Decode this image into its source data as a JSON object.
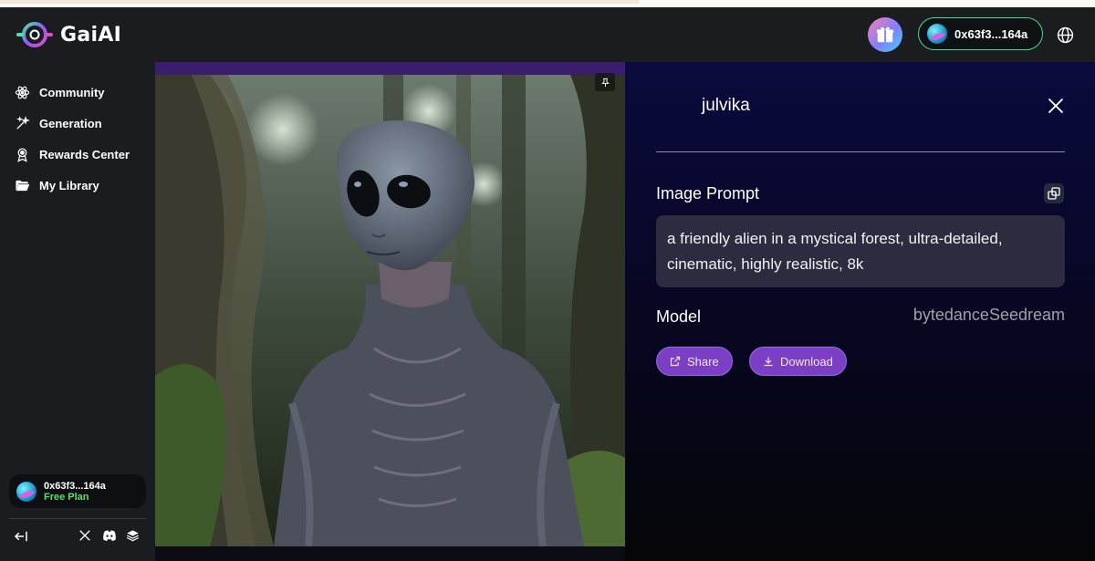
{
  "app": {
    "brand": "GaiAI"
  },
  "header": {
    "wallet_address": "0x63f3...164a"
  },
  "sidebar": {
    "items": [
      {
        "label": "Community",
        "icon": "atom-icon"
      },
      {
        "label": "Generation",
        "icon": "magic-wand-icon"
      },
      {
        "label": "Rewards Center",
        "icon": "award-ribbon-icon"
      },
      {
        "label": "My Library",
        "icon": "folder-open-icon"
      }
    ],
    "user": {
      "address": "0x63f3...164a",
      "plan": "Free Plan"
    },
    "footer_icons": [
      "collapse-sidebar-icon",
      "x-twitter-icon",
      "discord-icon",
      "docs-stack-icon"
    ]
  },
  "detail": {
    "username": "julvika",
    "prompt_label": "Image Prompt",
    "prompt_text": "a friendly alien in a mystical forest, ultra-detailed, cinematic, highly realistic, 8k",
    "model_label": "Model",
    "model_value": "bytedanceSeedream",
    "share_label": "Share",
    "download_label": "Download"
  },
  "colors": {
    "accent_green": "#49d98a",
    "plan_green": "#59e06b",
    "button_purple": "#7a3fc4",
    "panel_navy": "#0a0a3e"
  }
}
